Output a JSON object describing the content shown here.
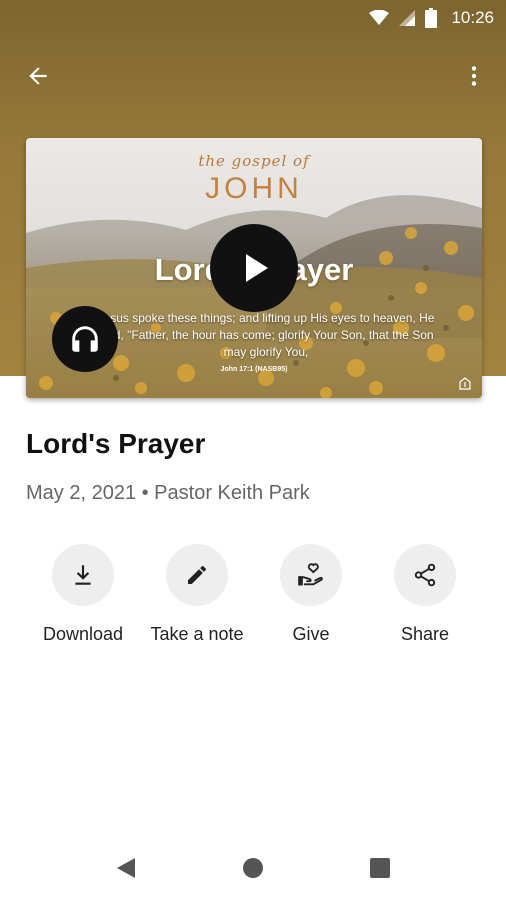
{
  "status_bar": {
    "time": "10:26",
    "icons": [
      "wifi-icon",
      "signal-icon",
      "battery-icon"
    ]
  },
  "app_bar": {
    "back_icon": "arrow-back-icon",
    "menu_icon": "more-vert-icon"
  },
  "media": {
    "series_kicker": "the gospel of",
    "series_name": "JOHN",
    "title": "Lord's Prayer",
    "verse_text": "Jesus spoke these things; and lifting up His eyes to heaven, He said, \"Father, the hour has come; glorify Your Son, that the Son may glorify You,",
    "verse_ref": "John 17:1 (NASB95)",
    "play_icon": "play-icon",
    "audio_icon": "headphones-icon"
  },
  "sermon": {
    "title": "Lord's Prayer",
    "meta": "May 2, 2021 • Pastor Keith Park"
  },
  "actions": [
    {
      "label": "Download",
      "icon": "download-icon"
    },
    {
      "label": "Take a note",
      "icon": "pencil-icon"
    },
    {
      "label": "Give",
      "icon": "give-hand-heart-icon"
    },
    {
      "label": "Share",
      "icon": "share-icon"
    }
  ],
  "nav_bar": {
    "icons": [
      "nav-back-icon",
      "nav-home-icon",
      "nav-recents-icon"
    ]
  },
  "colors": {
    "header": "#96793a",
    "accent_text": "#c4823e",
    "button_bg": "#eeeeee"
  }
}
